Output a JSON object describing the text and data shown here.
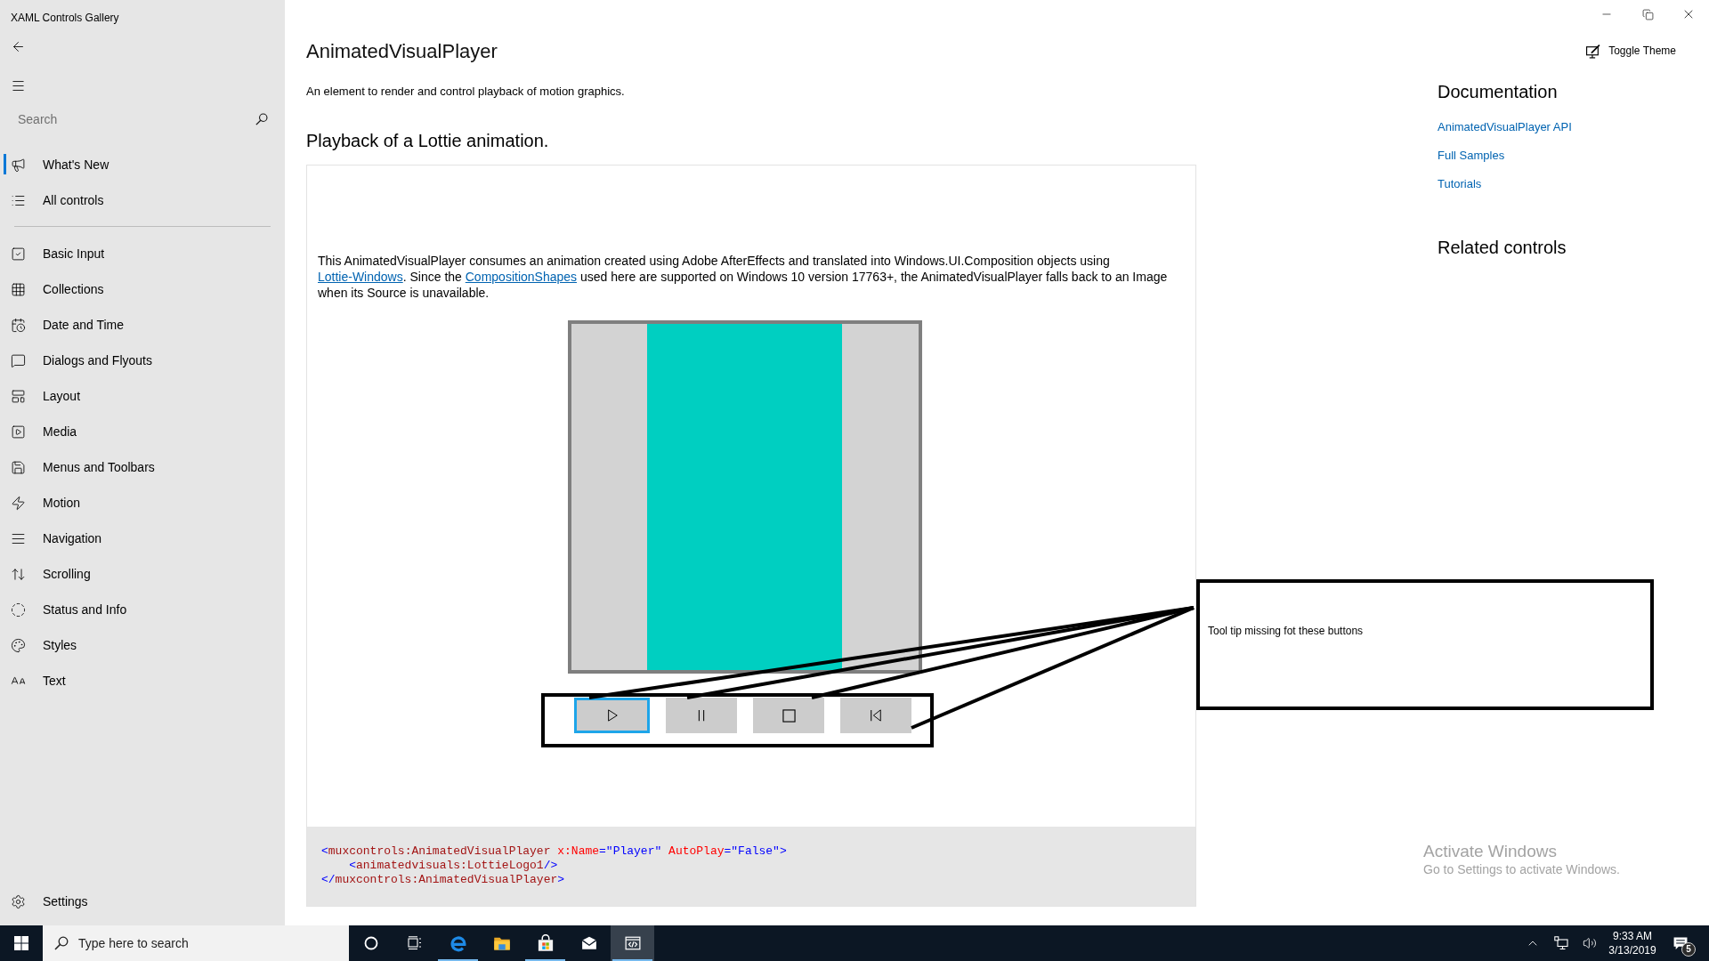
{
  "window": {
    "title": "XAML Controls Gallery"
  },
  "sidebar": {
    "search": {
      "placeholder": "Search"
    },
    "top_items": [
      {
        "label": "What's New",
        "selected": true
      },
      {
        "label": "All controls",
        "selected": false
      }
    ],
    "category_items": [
      {
        "label": "Basic Input",
        "selected": false
      },
      {
        "label": "Collections",
        "selected": false
      },
      {
        "label": "Date and Time",
        "selected": false
      },
      {
        "label": "Dialogs and Flyouts",
        "selected": false
      },
      {
        "label": "Layout",
        "selected": false
      },
      {
        "label": "Media",
        "selected": false
      },
      {
        "label": "Menus and Toolbars",
        "selected": false
      },
      {
        "label": "Motion",
        "selected": false
      },
      {
        "label": "Navigation",
        "selected": false
      },
      {
        "label": "Scrolling",
        "selected": false
      },
      {
        "label": "Status and Info",
        "selected": false
      },
      {
        "label": "Styles",
        "selected": false
      },
      {
        "label": "Text",
        "selected": false
      }
    ],
    "footer_items": [
      {
        "label": "Settings",
        "selected": false
      }
    ]
  },
  "header": {
    "toggle_theme": "Toggle Theme"
  },
  "page": {
    "title": "AnimatedVisualPlayer",
    "description": "An element to render and control playback of motion graphics.",
    "section_title": "Playback of a Lottie animation.",
    "example": {
      "paragraph": [
        {
          "kind": "text",
          "text": "This AnimatedVisualPlayer consumes an animation created using Adobe AfterEffects and translated into Windows.UI.Composition objects using "
        },
        {
          "kind": "link",
          "text": "Lottie-Windows"
        },
        {
          "kind": "text",
          "text": ". Since the "
        },
        {
          "kind": "link",
          "text": "CompositionShapes"
        },
        {
          "kind": "text",
          "text": " used here are supported on Windows 10 version 17763+, the AnimatedVisualPlayer falls back to an Image when its Source is unavailable."
        }
      ],
      "player_buttons": [
        {
          "focused": true
        },
        {
          "focused": false
        },
        {
          "focused": false
        },
        {
          "focused": false
        }
      ],
      "code": [
        {
          "tokens": [
            {
              "kind": "punct",
              "text": "<"
            },
            {
              "kind": "tag",
              "text": "muxcontrols:AnimatedVisualPlayer"
            },
            {
              "kind": "attr",
              "text": " x:Name"
            },
            {
              "kind": "value",
              "text": "=\"Player\""
            },
            {
              "kind": "attr",
              "text": " AutoPlay"
            },
            {
              "kind": "value",
              "text": "=\"False\""
            },
            {
              "kind": "punct",
              "text": ">"
            }
          ],
          "children": [
            {
              "tokens": [
                {
                  "kind": "punct",
                  "text": "<"
                },
                {
                  "kind": "tag",
                  "text": "animatedvisuals:LottieLogo1"
                },
                {
                  "kind": "punct",
                  "text": "/>"
                }
              ]
            }
          ]
        },
        {
          "tokens": [
            {
              "kind": "punct",
              "text": "</"
            },
            {
              "kind": "tag",
              "text": "muxcontrols:AnimatedVisualPlayer"
            },
            {
              "kind": "punct",
              "text": ">"
            }
          ]
        }
      ]
    }
  },
  "annotation": {
    "text": "Tool tip missing fot these buttons"
  },
  "documentation": {
    "title": "Documentation",
    "links": [
      "AnimatedVisualPlayer API",
      "Full Samples",
      "Tutorials"
    ]
  },
  "related_controls": {
    "title": "Related controls"
  },
  "activation_notice": {
    "title": "Activate Windows",
    "subtitle": "Go to Settings to activate Windows."
  },
  "taskbar": {
    "search": {
      "placeholder": "Type here to search"
    },
    "buttons": [
      {
        "selected": false,
        "running": false
      },
      {
        "selected": false,
        "running": false
      },
      {
        "selected": false,
        "running": true
      },
      {
        "selected": false,
        "running": false
      },
      {
        "selected": false,
        "running": true
      },
      {
        "selected": false,
        "running": false
      },
      {
        "selected": true,
        "running": true
      }
    ],
    "clock": {
      "time": "9:33 AM",
      "date": "3/13/2019"
    },
    "notification_count": "5"
  }
}
